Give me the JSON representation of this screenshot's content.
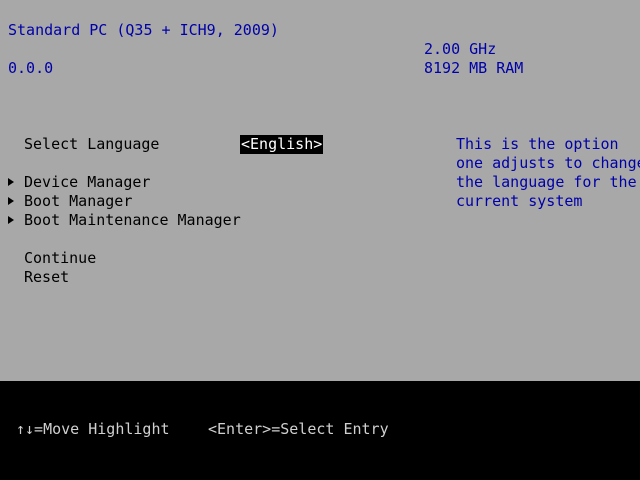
{
  "header": {
    "platform": "Standard PC (Q35 + ICH9, 2009)",
    "version": "0.0.0",
    "cpu_speed": "2.00 GHz",
    "memory": "8192 MB RAM"
  },
  "menu": {
    "language_label": "Select Language",
    "language_value": "<English>",
    "device_manager": "Device Manager",
    "boot_manager": "Boot Manager",
    "boot_maintenance_manager": "Boot Maintenance Manager",
    "continue": "Continue",
    "reset": "Reset"
  },
  "help": {
    "line1": "This is the option",
    "line2": "one adjusts to change",
    "line3": "the language for the",
    "line4": "current system"
  },
  "footer": {
    "move_hint": "↑↓=Move Highlight",
    "select_hint": "<Enter>=Select Entry"
  },
  "colors": {
    "background": "#a8a8a8",
    "header_text": "#0000a8",
    "menu_text": "#000000",
    "footer_bg": "#000000",
    "footer_text": "#d0d0d0"
  }
}
